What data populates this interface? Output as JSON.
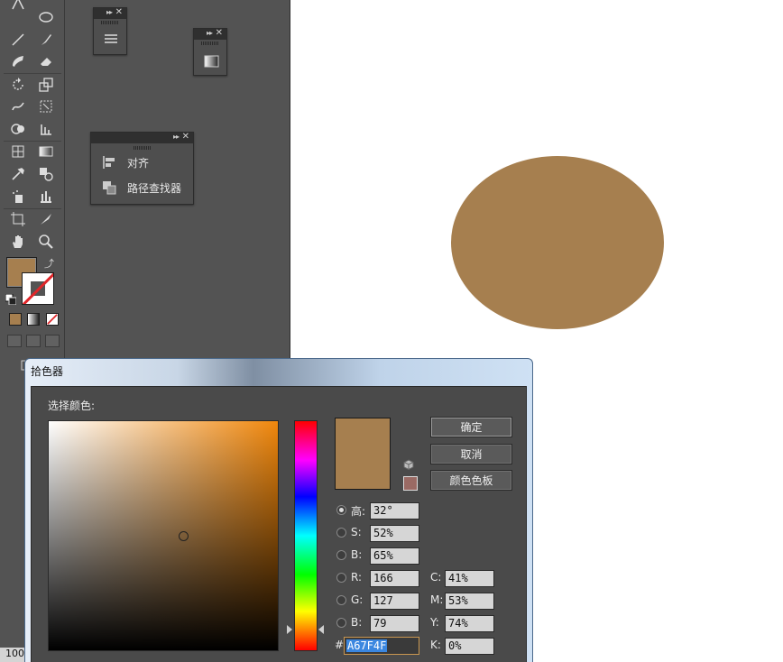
{
  "panels": {
    "align_label": "对齐",
    "pathfinder_label": "路径查找器"
  },
  "status": {
    "zoom": "100"
  },
  "colors": {
    "fill": "#a67f4f",
    "accent_ok_border": "#9a9a9a"
  },
  "tools": [
    "pen-icon",
    "ellipse-icon",
    "line-icon",
    "brush-icon",
    "blob-brush-icon",
    "eraser-icon",
    "rotate-icon",
    "scale-icon",
    "warp-icon",
    "free-transform-icon",
    "shape-builder-icon",
    "graph-icon",
    "mesh-icon",
    "gradient-icon",
    "eyedropper-icon",
    "blend-icon",
    "symbol-sprayer-icon",
    "column-graph-icon",
    "artboard-icon",
    "slice-icon",
    "hand-icon",
    "zoom-icon"
  ],
  "dialog": {
    "title": "拾色器",
    "select_label": "选择颜色:",
    "buttons": {
      "ok": "确定",
      "cancel": "取消",
      "swatches": "颜色色板"
    },
    "hsb": {
      "h_label": "高:",
      "h": "32°",
      "s_label": "S:",
      "s": "52%",
      "b_label": "B:",
      "b": "65%"
    },
    "rgb": {
      "r_label": "R:",
      "r": "166",
      "g_label": "G:",
      "g": "127",
      "b_label": "B:",
      "b": "79"
    },
    "cmyk": {
      "c_label": "C:",
      "c": "41%",
      "m_label": "M:",
      "m": "53%",
      "y_label": "Y:",
      "y": "74%",
      "k_label": "K:",
      "k": "0%"
    },
    "hex_label": "#",
    "hex": "A67F4F"
  }
}
